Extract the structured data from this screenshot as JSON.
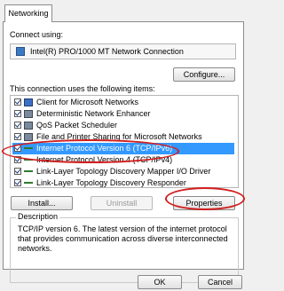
{
  "tabs": [
    {
      "label": "Networking"
    }
  ],
  "connect_using": {
    "label": "Connect using:",
    "adapter": "Intel(R) PRO/1000 MT Network Connection"
  },
  "configure_label": "Configure...",
  "items_label": "This connection uses the following items:",
  "items": [
    {
      "label": "Client for Microsoft Networks",
      "checked": true,
      "icon": "client-icon"
    },
    {
      "label": "Deterministic Network Enhancer",
      "checked": true,
      "icon": "service-icon"
    },
    {
      "label": "QoS Packet Scheduler",
      "checked": true,
      "icon": "service-icon"
    },
    {
      "label": "File and Printer Sharing for Microsoft Networks",
      "checked": true,
      "icon": "service-icon"
    },
    {
      "label": "Internet Protocol Version 6 (TCP/IPv6)",
      "checked": true,
      "icon": "protocol-icon",
      "selected": true
    },
    {
      "label": "Internet Protocol Version 4 (TCP/IPv4)",
      "checked": true,
      "icon": "protocol-icon"
    },
    {
      "label": "Link-Layer Topology Discovery Mapper I/O Driver",
      "checked": true,
      "icon": "protocol-icon"
    },
    {
      "label": "Link-Layer Topology Discovery Responder",
      "checked": true,
      "icon": "protocol-icon"
    }
  ],
  "buttons": {
    "install": "Install...",
    "uninstall": "Uninstall",
    "properties": "Properties",
    "ok": "OK",
    "cancel": "Cancel"
  },
  "description": {
    "legend": "Description",
    "text": "TCP/IP version 6. The latest version of the internet protocol that provides communication across diverse interconnected networks."
  },
  "colors": {
    "highlight_ellipse": "#d11e1e",
    "selection": "#3399ff"
  }
}
